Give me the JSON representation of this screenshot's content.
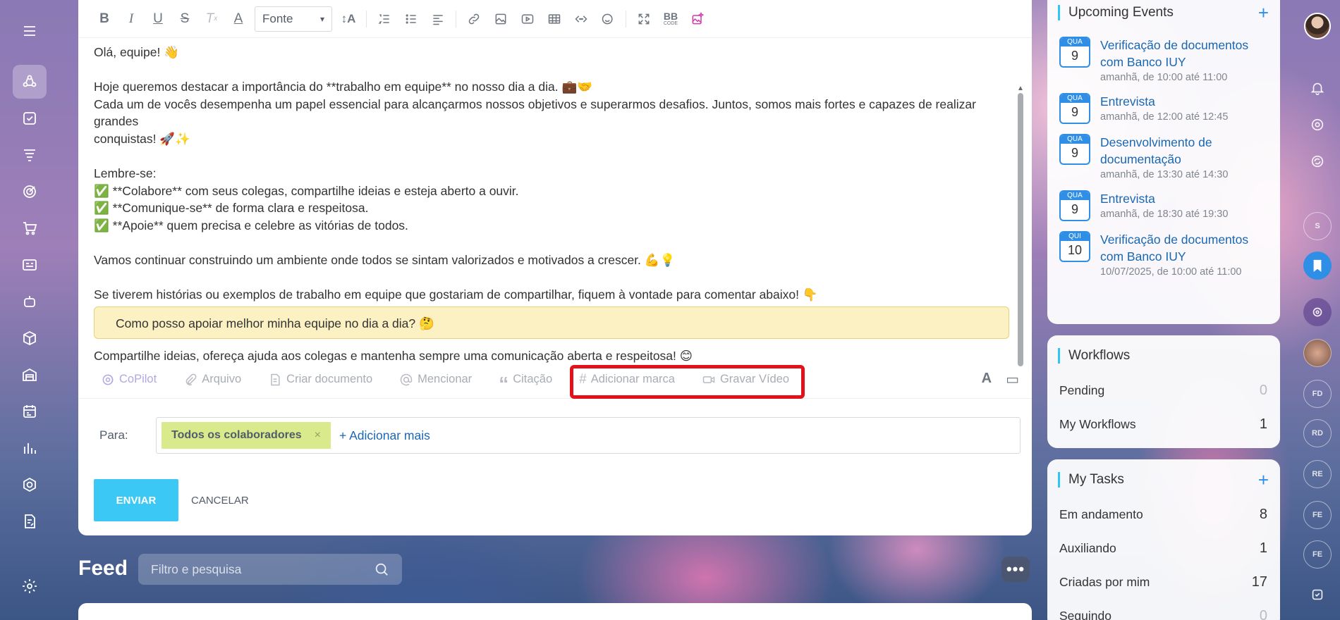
{
  "toolbar": {
    "font_select": "Fonte",
    "bb_code_label_top": "BB",
    "bb_code_label_bottom": "CODE"
  },
  "editor": {
    "lines": [
      "Olá, equipe! 👋",
      "",
      "Hoje queremos destacar a importância do **trabalho em equipe** no nosso dia a dia. 💼🤝",
      "Cada um de vocês desempenha um papel essencial para alcançarmos nossos objetivos e superarmos desafios. Juntos, somos mais fortes e capazes de realizar grandes",
      "conquistas! 🚀✨",
      "",
      "Lembre-se:",
      "✅ **Colabore** com seus colegas, compartilhe ideias e esteja aberto a ouvir.",
      "✅ **Comunique-se** de forma clara e respeitosa.",
      "✅ **Apoie** quem precisa e celebre as vitórias de todos.",
      "",
      "Vamos continuar construindo um ambiente onde todos se sintam valorizados e motivados a crescer. 💪💡",
      "",
      "Se tiverem histórias ou exemplos de trabalho em equipe que gostariam de compartilhar, fiquem à vontade para comentar abaixo! 👇"
    ],
    "quote": "Como posso apoiar melhor minha equipe no dia a dia? 🤔",
    "closing": "Compartilhe ideias, ofereça ajuda aos colegas e mantenha sempre uma comunicação aberta e respeitosa! 😊"
  },
  "bottom_bar": {
    "copilot": "CoPilot",
    "file": "Arquivo",
    "create_doc": "Criar documento",
    "mention": "Mencionar",
    "quote": "Citação",
    "add_tag": "Adicionar marca",
    "record_video": "Gravar Vídeo",
    "highlight_color": "#e4101a"
  },
  "recipients": {
    "label": "Para:",
    "chip": "Todos os colaboradores",
    "chip_remove": "×",
    "add_more": "+ Adicionar mais"
  },
  "actions": {
    "send": "ENVIAR",
    "cancel": "CANCELAR"
  },
  "feed": {
    "title": "Feed",
    "search_placeholder": "Filtro e pesquisa",
    "more": "•••"
  },
  "upcoming_events": {
    "title": "Upcoming Events",
    "add": "+",
    "events": [
      {
        "dow": "QUA",
        "day": "9",
        "title": "Verificação de documentos com Banco IUY",
        "time": "amanhã, de 10:00 até 11:00"
      },
      {
        "dow": "QUA",
        "day": "9",
        "title": "Entrevista",
        "time": "amanhã, de 12:00 até 12:45"
      },
      {
        "dow": "QUA",
        "day": "9",
        "title": "Desenvolvimento de documentação",
        "time": "amanhã, de 13:30 até 14:30"
      },
      {
        "dow": "QUA",
        "day": "9",
        "title": "Entrevista",
        "time": "amanhã, de 18:30 até 19:30"
      },
      {
        "dow": "QUI",
        "day": "10",
        "title": "Verificação de documentos com Banco IUY",
        "time": "10/07/2025, de 10:00 até 11:00"
      }
    ]
  },
  "workflows": {
    "title": "Workflows",
    "rows": [
      {
        "label": "Pending",
        "value": "0"
      },
      {
        "label": "My Workflows",
        "value": "1"
      }
    ]
  },
  "my_tasks": {
    "title": "My Tasks",
    "add": "+",
    "rows": [
      {
        "label": "Em andamento",
        "value": "8"
      },
      {
        "label": "Auxiliando",
        "value": "1"
      },
      {
        "label": "Criadas por mim",
        "value": "17"
      },
      {
        "label": "Seguindo",
        "value": "0"
      }
    ]
  },
  "right_rail": {
    "avatars": [
      "S",
      "FD",
      "RD",
      "RE",
      "FE",
      "FE"
    ]
  }
}
